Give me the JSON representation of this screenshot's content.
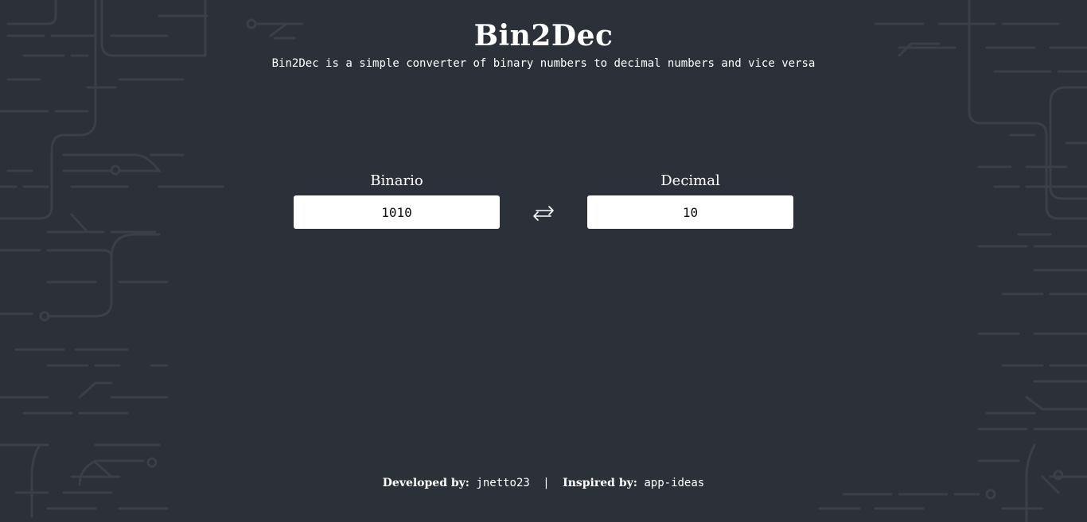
{
  "header": {
    "title": "Bin2Dec",
    "subtitle": "Bin2Dec is a simple converter of binary numbers to decimal numbers and vice versa"
  },
  "converter": {
    "binary_label": "Binario",
    "binary_value": "1010",
    "decimal_label": "Decimal",
    "decimal_value": "10",
    "swap_icon": "swap-arrows-icon"
  },
  "footer": {
    "developed_label": "Developed by:",
    "developer_link": "jnetto23",
    "separator": "|",
    "inspired_label": "Inspired by:",
    "inspired_link": "app-ideas"
  },
  "colors": {
    "background": "#2c3038",
    "circuit_lines": "#3a3f48",
    "text": "#ffffff",
    "input_background": "#ffffff"
  }
}
